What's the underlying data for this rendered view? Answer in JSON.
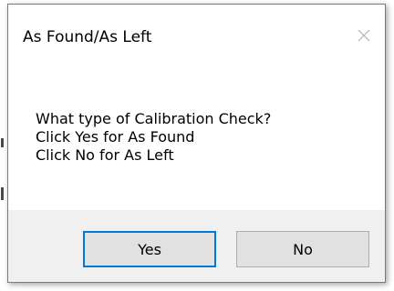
{
  "dialog": {
    "title": "As Found/As Left",
    "message_lines": [
      "What type of Calibration Check?",
      "Click Yes for As Found",
      "Click No for As Left"
    ],
    "buttons": {
      "yes_label": "Yes",
      "no_label": "No"
    },
    "close_icon": "close-icon"
  },
  "colors": {
    "footer_bg": "#f0f0f0",
    "button_bg": "#e1e1e1",
    "default_button_border": "#0078d7"
  }
}
